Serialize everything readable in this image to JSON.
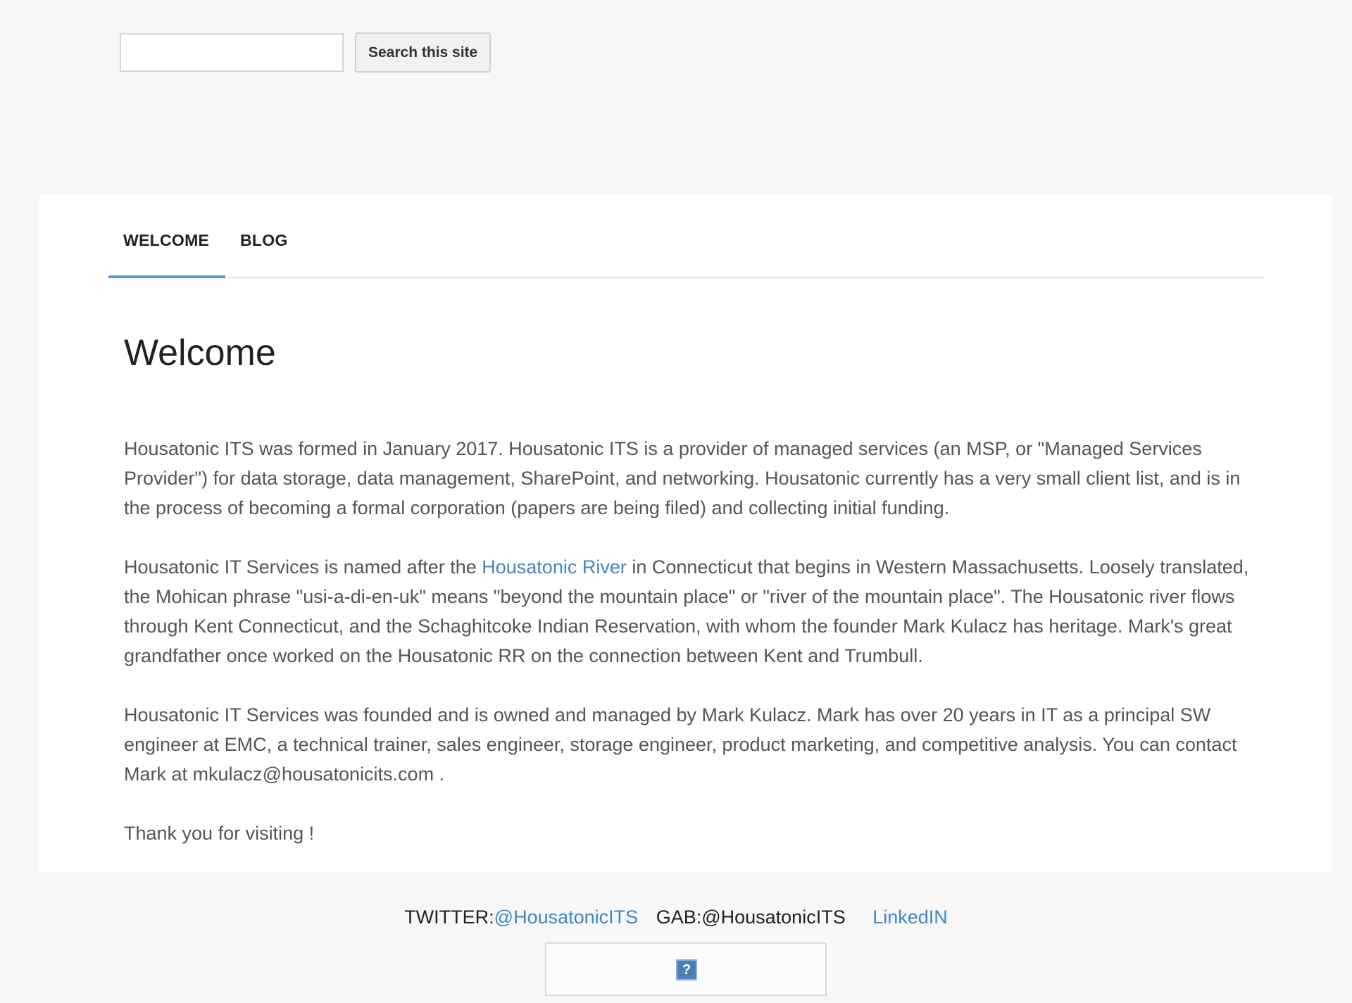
{
  "search": {
    "placeholder": "",
    "button_label": "Search this site"
  },
  "nav": {
    "tabs": [
      {
        "label": "WELCOME",
        "active": true
      },
      {
        "label": "BLOG",
        "active": false
      }
    ]
  },
  "main": {
    "title": "Welcome",
    "paragraph1": "Housatonic ITS was formed in January 2017. Housatonic ITS is a provider of managed services (an MSP, or \"Managed Services Provider\") for data storage, data management, SharePoint, and networking. Housatonic currently has a very small client list, and is in the process of becoming a formal corporation (papers are being filed) and collecting initial funding.",
    "paragraph2_before": "Housatonic IT Services is named after the ",
    "paragraph2_link": "Housatonic River",
    "paragraph2_after": " in Connecticut that begins in Western Massachusetts. Loosely translated, the Mohican phrase \"usi-a-di-en-uk\" means \"beyond the mountain place\" or \"river of the mountain place\". The Housatonic river flows through Kent Connecticut, and the Schaghitcoke Indian Reservation, with whom the founder Mark Kulacz has heritage. Mark's great grandfather once worked on the Housatonic RR on the connection between Kent and Trumbull.",
    "paragraph3": "Housatonic IT Services was founded and is owned and managed by Mark Kulacz. Mark has over 20 years in IT as a principal SW engineer at EMC, a technical trainer, sales engineer, storage engineer, product marketing, and competitive analysis. You can contact Mark at mkulacz@housatonicits.com .",
    "paragraph4": "Thank you for visiting !"
  },
  "footer": {
    "twitter_label": "TWITTER:",
    "twitter_handle": "@HousatonicITS",
    "gab_label": "GAB:@HousatonicITS",
    "linkedin_label": "LinkedIN",
    "badge_glyph": "?"
  },
  "colors": {
    "background": "#f7f7f7",
    "panel": "#ffffff",
    "link": "#3f87c8",
    "active_tab_underline": "#5c93cf"
  }
}
